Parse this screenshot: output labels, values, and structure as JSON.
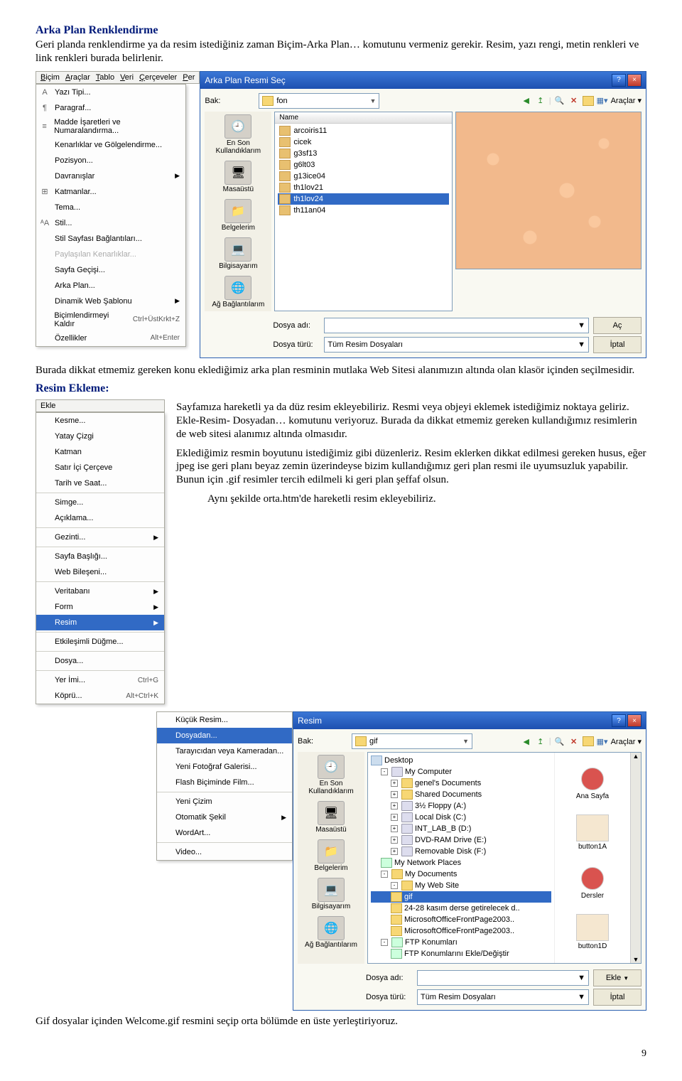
{
  "doc": {
    "h1": "Arka Plan Renklendirme",
    "p1": "Geri planda renklendirme ya da resim istediğiniz zaman Biçim-Arka Plan… komutunu vermeniz gerekir. Resim, yazı rengi, metin renkleri ve link renkleri burada belirlenir.",
    "p2": "Burada dikkat etmemiz gereken konu eklediğimiz arka plan resminin mutlaka Web Sitesi alanımızın altında olan klasör içinden seçilmesidir.",
    "h2": "Resim Ekleme:",
    "p3": "Sayfamıza hareketli ya da düz resim ekleyebiliriz. Resmi veya objeyi eklemek istediğimiz noktaya geliriz. Ekle-Resim- Dosyadan… komutunu veriyoruz. Burada da dikkat etmemiz gereken kullandığımız resimlerin de web sitesi alanımız altında olmasıdır.",
    "p4": "Eklediğimiz resmin boyutunu istediğimiz gibi düzenleriz. Resim eklerken dikkat edilmesi gereken husus, eğer jpeg ise geri planı beyaz zemin üzerindeyse bizim kullandığımız geri plan resmi ile uyumsuzluk yapabilir. Bunun için .gif resimler tercih edilmeli ki geri plan şeffaf olsun.",
    "p5": "Aynı şekilde orta.htm'de hareketli resim ekleyebiliriz.",
    "p6": "Gif dosyalar içinden Welcome.gif resmini seçip orta bölümde en üste yerleştiriyoruz.",
    "page": "9"
  },
  "menubar1": [
    "Biçim",
    "Araçlar",
    "Tablo",
    "Veri",
    "Çerçeveler",
    "Per"
  ],
  "bicim_menu": [
    {
      "icon": "A",
      "label": "Yazı Tipi..."
    },
    {
      "icon": "¶",
      "label": "Paragraf..."
    },
    {
      "icon": "≡",
      "label": "Madde İşaretleri ve Numaralandırma..."
    },
    {
      "icon": "",
      "label": "Kenarlıklar ve Gölgelendirme..."
    },
    {
      "icon": "",
      "label": "Pozisyon..."
    },
    {
      "icon": "",
      "label": "Davranışlar",
      "arrow": true
    },
    {
      "icon": "⊞",
      "label": "Katmanlar..."
    },
    {
      "icon": "",
      "label": "Tema..."
    },
    {
      "icon": "ᴬA",
      "label": "Stil..."
    },
    {
      "icon": "",
      "label": "Stil Sayfası Bağlantıları..."
    },
    {
      "icon": "",
      "label": "Paylaşılan Kenarlıklar...",
      "disabled": true
    },
    {
      "icon": "",
      "label": "Sayfa Geçişi..."
    },
    {
      "icon": "",
      "label": "Arka Plan..."
    },
    {
      "icon": "",
      "label": "Dinamik Web Şablonu",
      "arrow": true
    },
    {
      "icon": "",
      "label": "Biçimlendirmeyi Kaldır",
      "shortcut": "Ctrl+ÜstKrkt+Z"
    },
    {
      "icon": "",
      "label": "Özellikler",
      "shortcut": "Alt+Enter"
    }
  ],
  "dialog1": {
    "title": "Arka Plan Resmi Seç",
    "bak": "Bak:",
    "folder": "fon",
    "tools": "Araçlar",
    "name_hdr": "Name",
    "files": [
      "arcoiris11",
      "cicek",
      "g3sf13",
      "g6lt03",
      "g13ice04",
      "th1lov21",
      "th1lov24",
      "th11an04"
    ],
    "selected": "th1lov24",
    "places": [
      "En Son Kullandıklarım",
      "Masaüstü",
      "Belgelerim",
      "Bilgisayarım",
      "Ağ Bağlantılarım"
    ],
    "dosya_adi": "Dosya adı:",
    "dosya_turu": "Dosya türü:",
    "turu_val": "Tüm Resim Dosyaları",
    "ac": "Aç",
    "iptal": "İptal"
  },
  "ekle_menu": {
    "title": "Ekle",
    "items": [
      {
        "label": "Kesme..."
      },
      {
        "label": "Yatay Çizgi"
      },
      {
        "label": "Katman"
      },
      {
        "label": "Satır İçi Çerçeve"
      },
      {
        "label": "Tarih ve Saat..."
      },
      {
        "sep": true
      },
      {
        "label": "Simge..."
      },
      {
        "label": "Açıklama..."
      },
      {
        "sep": true
      },
      {
        "label": "Gezinti...",
        "arrow": true
      },
      {
        "sep": true
      },
      {
        "label": "Sayfa Başlığı..."
      },
      {
        "label": "Web Bileşeni..."
      },
      {
        "sep": true
      },
      {
        "label": "Veritabanı",
        "arrow": true
      },
      {
        "label": "Form",
        "arrow": true
      },
      {
        "label": "Resim",
        "arrow": true,
        "sel": true
      },
      {
        "sep": true
      },
      {
        "label": "Etkileşimli Düğme..."
      },
      {
        "sep": true
      },
      {
        "label": "Dosya..."
      },
      {
        "sep": true
      },
      {
        "label": "Yer İmi...",
        "shortcut": "Ctrl+G"
      },
      {
        "label": "Köprü...",
        "shortcut": "Alt+Ctrl+K"
      }
    ]
  },
  "resim_submenu": [
    {
      "label": "Küçük Resim..."
    },
    {
      "label": "Dosyadan...",
      "sel": true
    },
    {
      "label": "Tarayıcıdan veya Kameradan..."
    },
    {
      "label": "Yeni Fotoğraf Galerisi..."
    },
    {
      "label": "Flash Biçiminde Film..."
    },
    {
      "sep": true
    },
    {
      "label": "Yeni Çizim"
    },
    {
      "label": "Otomatik Şekil",
      "arrow": true
    },
    {
      "label": "WordArt..."
    },
    {
      "sep": true
    },
    {
      "label": "Video..."
    }
  ],
  "dialog2": {
    "title": "Resim",
    "bak": "Bak:",
    "folder": "gif",
    "tools": "Araçlar",
    "places": [
      "En Son Kullandıklarım",
      "Masaüstü",
      "Belgelerim",
      "Bilgisayarım",
      "Ağ Bağlantılarım"
    ],
    "tree": {
      "Desktop": "Desktop",
      "MyComputer": "My Computer",
      "genel": "genel's Documents",
      "Shared": "Shared Documents",
      "Floppy": "3½ Floppy (A:)",
      "LocalC": "Local Disk (C:)",
      "INTLAB": "INT_LAB_B (D:)",
      "DVD": "DVD-RAM Drive (E:)",
      "Remov": "Removable Disk (F:)",
      "NetPlaces": "My Network Places",
      "MyDocs": "My Documents",
      "MyWeb": "My Web Site",
      "gif": "gif",
      "kasim": "24-28 kasım derse getirelecek d..",
      "fp1": "MicrosoftOfficeFrontPage2003..",
      "fp2": "MicrosoftOfficeFrontPage2003..",
      "FTP": "FTP Konumları",
      "FTPAdd": "FTP Konumlarını Ekle/Değiştir"
    },
    "thumbs": [
      "Ana Sayfa",
      "button1A",
      "Dersler",
      "button1D"
    ],
    "dosya_adi": "Dosya adı:",
    "dosya_turu": "Dosya türü:",
    "turu_val": "Tüm Resim Dosyaları",
    "ekle": "Ekle",
    "iptal": "İptal"
  }
}
